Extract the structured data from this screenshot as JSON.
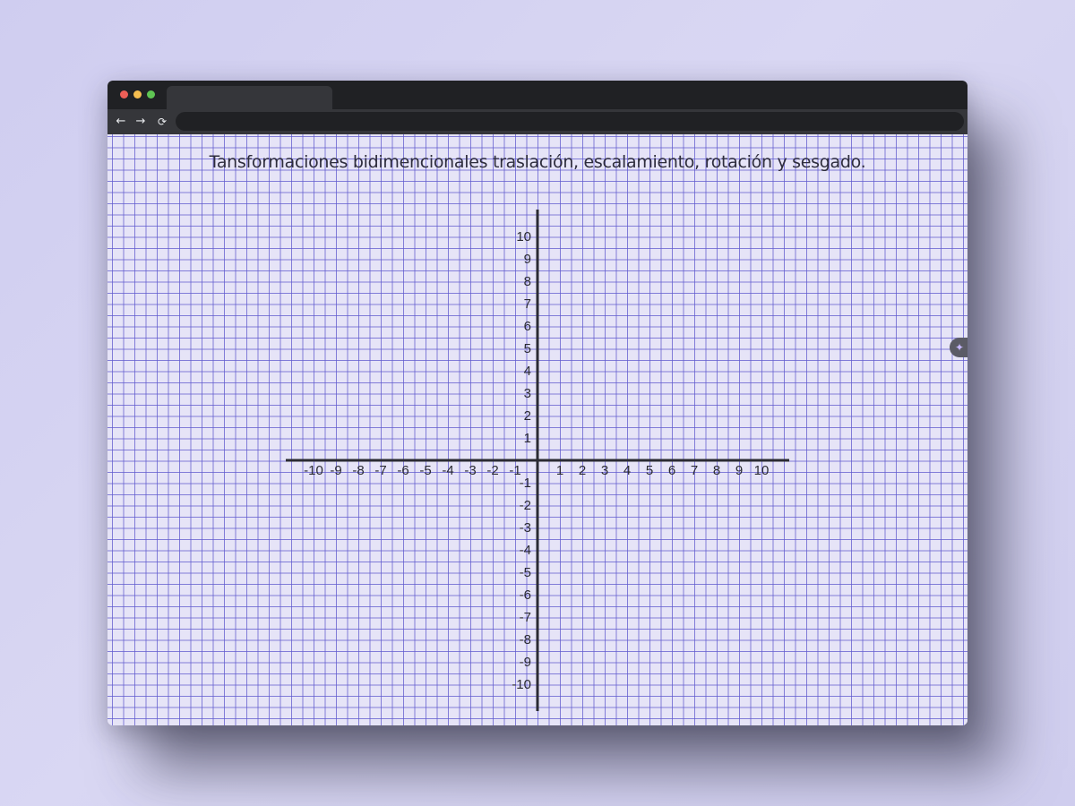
{
  "browser": {
    "tab_title": "",
    "address": "",
    "back_icon": "←",
    "forward_icon": "→",
    "reload_icon": "⟳"
  },
  "page": {
    "title": "Tansformaciones bidimencionales traslación, escalamiento, rotación y sesgado."
  },
  "side_button": {
    "icon": "sparkle-icon",
    "glyph": "✦"
  },
  "colors": {
    "grid_line": "#5f5acd",
    "grid_bg": "#e6e4f7",
    "axis": "#2b2b33",
    "titlebar": "#202124"
  },
  "chart_data": {
    "type": "cartesian-plane",
    "x_ticks": [
      -10,
      -9,
      -8,
      -7,
      -6,
      -5,
      -4,
      -3,
      -2,
      -1,
      1,
      2,
      3,
      4,
      5,
      6,
      7,
      8,
      9,
      10
    ],
    "y_ticks": [
      10,
      9,
      8,
      7,
      6,
      5,
      4,
      3,
      2,
      1,
      -1,
      -2,
      -3,
      -4,
      -5,
      -6,
      -7,
      -8,
      -9,
      -10
    ],
    "xlim": [
      -11,
      11
    ],
    "ylim": [
      -11,
      11
    ],
    "grid": true
  }
}
